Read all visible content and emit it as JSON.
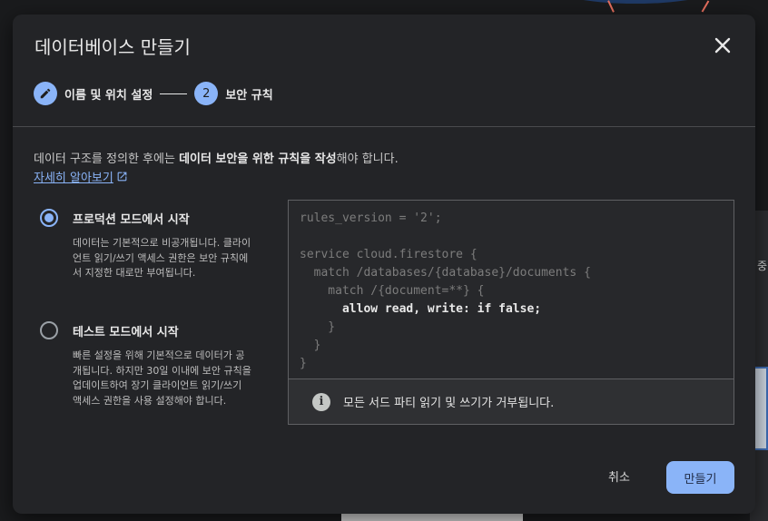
{
  "dialog": {
    "title": "데이터베이스 만들기",
    "close_icon": "close-icon"
  },
  "stepper": {
    "steps": [
      {
        "marker": "pencil-icon",
        "label": "이름 및 위치 설정",
        "state": "completed"
      },
      {
        "marker": "2",
        "label": "보안 규칙",
        "state": "active"
      }
    ]
  },
  "description": {
    "text_before": "데이터 구조를 정의한 후에는 ",
    "text_bold": "데이터 보안을 위한 규칙을 작성",
    "text_after": "해야 합니다.",
    "link_label": "자세히 알아보기",
    "link_icon": "external-link-icon"
  },
  "options": [
    {
      "title": "프로덕션 모드에서 시작",
      "description": "데이터는 기본적으로 비공개됩니다. 클라이언트 읽기/쓰기 액세스 권한은 보안 규칙에서 지정한 대로만 부여됩니다.",
      "selected": true
    },
    {
      "title": "테스트 모드에서 시작",
      "description": "빠른 설정을 위해 기본적으로 데이터가 공개됩니다. 하지만 30일 이내에 보안 규칙을 업데이트하여 장기 클라이언트 읽기/쓰기 액세스 권한을 사용 설정해야 합니다.",
      "selected": false
    }
  ],
  "code": {
    "lines": [
      "rules_version = '2';",
      "",
      "service cloud.firestore {",
      "  match /databases/{database}/documents {",
      "    match /{document=**} {",
      "      allow read, write: if false;",
      "    }",
      "  }",
      "}"
    ],
    "highlight_line": 5
  },
  "info": {
    "icon": "info-icon",
    "text": "모든 서드 파티 읽기 및 쓰기가 거부됩니다."
  },
  "actions": {
    "cancel_label": "취소",
    "create_label": "만들기"
  },
  "background": {
    "right_text": "중"
  },
  "colors": {
    "accent": "#8ab4f8",
    "dialog_bg": "#232427"
  }
}
